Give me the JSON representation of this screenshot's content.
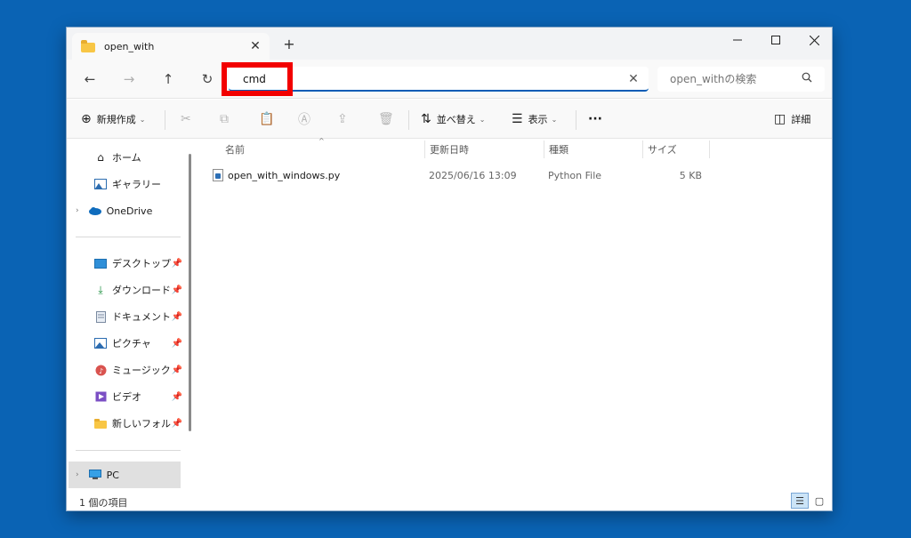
{
  "window": {
    "tab_title": "open_with",
    "new_tab": "+"
  },
  "nav": {
    "address_value": "cmd",
    "search_placeholder": "open_withの検索"
  },
  "toolbar": {
    "new_label": "新規作成",
    "sort_label": "並べ替え",
    "view_label": "表示",
    "more_label": "···",
    "details_label": "詳細"
  },
  "sidebar": {
    "items": [
      {
        "label": "ホーム",
        "icon": "home-icon"
      },
      {
        "label": "ギャラリー",
        "icon": "gallery-icon"
      },
      {
        "label": "OneDrive",
        "icon": "cloud-icon"
      },
      {
        "label": "デスクトップ",
        "icon": "desktop-icon"
      },
      {
        "label": "ダウンロード",
        "icon": "download-icon"
      },
      {
        "label": "ドキュメント",
        "icon": "document-icon"
      },
      {
        "label": "ピクチャ",
        "icon": "pictures-icon"
      },
      {
        "label": "ミュージック",
        "icon": "music-icon"
      },
      {
        "label": "ビデオ",
        "icon": "video-icon"
      },
      {
        "label": "新しいフォルダ-",
        "icon": "folder-icon"
      },
      {
        "label": "PC",
        "icon": "pc-icon"
      }
    ]
  },
  "columns": [
    "名前",
    "更新日時",
    "種類",
    "サイズ"
  ],
  "files": [
    {
      "name": "open_with_windows.py",
      "modified": "2025/06/16 13:09",
      "type": "Python File",
      "size": "5 KB"
    }
  ],
  "status": {
    "count": "1 個の項目"
  },
  "colors": {
    "desktop": "#0a63b4",
    "accent": "#0a5db6",
    "highlight_frame": "#f20000"
  }
}
